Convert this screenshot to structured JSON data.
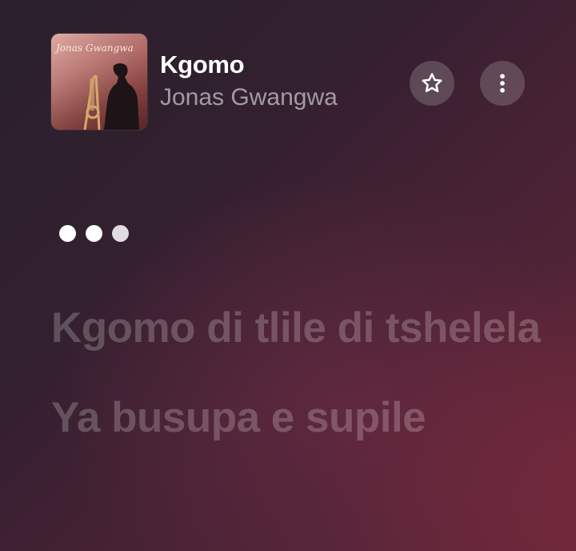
{
  "track": {
    "title": "Kgomo",
    "artist": "Jonas Gwangwa",
    "album_art_text": "Jonas Gwangwa"
  },
  "actions": {
    "favorite_icon": "star-outline-icon",
    "more_icon": "vertical-ellipsis-icon"
  },
  "loading_indicator": {
    "dots": 3
  },
  "lyrics": [
    "Kgomo di tlile di tshelela",
    "Ya busupa e supile"
  ],
  "colors": {
    "background_dark": "#2a1f2d",
    "background_accent": "#5e2838",
    "text_primary": "#ffffff",
    "text_secondary": "#b7a9b3"
  }
}
